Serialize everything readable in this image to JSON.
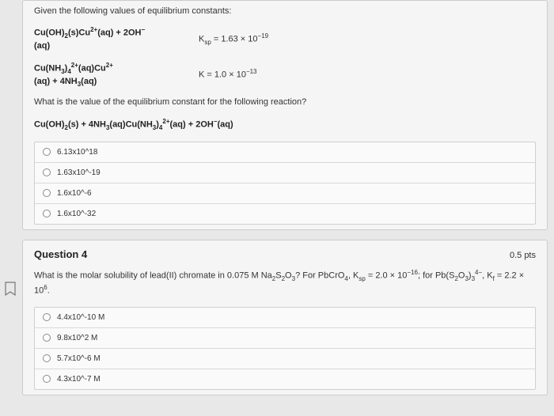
{
  "q3": {
    "intro": "Given the following values of equilibrium constants:",
    "rxn1": {
      "line1_html": "Cu(OH)<sub>2</sub>(s)Cu<sup>2+</sup>(aq) + 2OH<sup>−</sup>",
      "line2_html": "(aq)",
      "K_html": "K<sub>sp</sub> = 1.63 × 10<sup>−19</sup>"
    },
    "rxn2": {
      "line1_html": "Cu(NH<sub>3</sub>)<sub>4</sub><sup>2+</sup>(aq)Cu<sup>2+</sup>",
      "line2_html": "(aq) + 4NH<sub>3</sub>(aq)",
      "K_html": "K = 1.0 × 10<sup>−13</sup>"
    },
    "prompt1": "What is the value of the equilibrium constant for the following reaction?",
    "target_html": "Cu(OH)<sub>2</sub>(s) + 4NH<sub>3</sub>(aq)Cu(NH<sub>3</sub>)<sub>4</sub><sup>2+</sup>(aq) + 2OH<sup>−</sup>(aq)",
    "choices": [
      "6.13x10^18",
      "1.63x10^-19",
      "1.6x10^-6",
      "1.6x10^-32"
    ]
  },
  "q4": {
    "title": "Question 4",
    "points": "0.5 pts",
    "prompt_html": "What is the molar solubility of lead(II) chromate in 0.075 M Na<sub>2</sub>S<sub>2</sub>O<sub>3</sub>? For PbCrO<sub>4</sub>, K<sub>sp</sub> = 2.0 × 10<sup>−16</sup>; for Pb(S<sub>2</sub>O<sub>3</sub>)<sub>3</sub><sup>4−</sup>, K<sub>f</sub> = 2.2 × 10<sup>6</sup>.",
    "choices": [
      "4.4x10^-10 M",
      "9.8x10^2 M",
      "5.7x10^-6 M",
      "4.3x10^-7 M"
    ]
  }
}
